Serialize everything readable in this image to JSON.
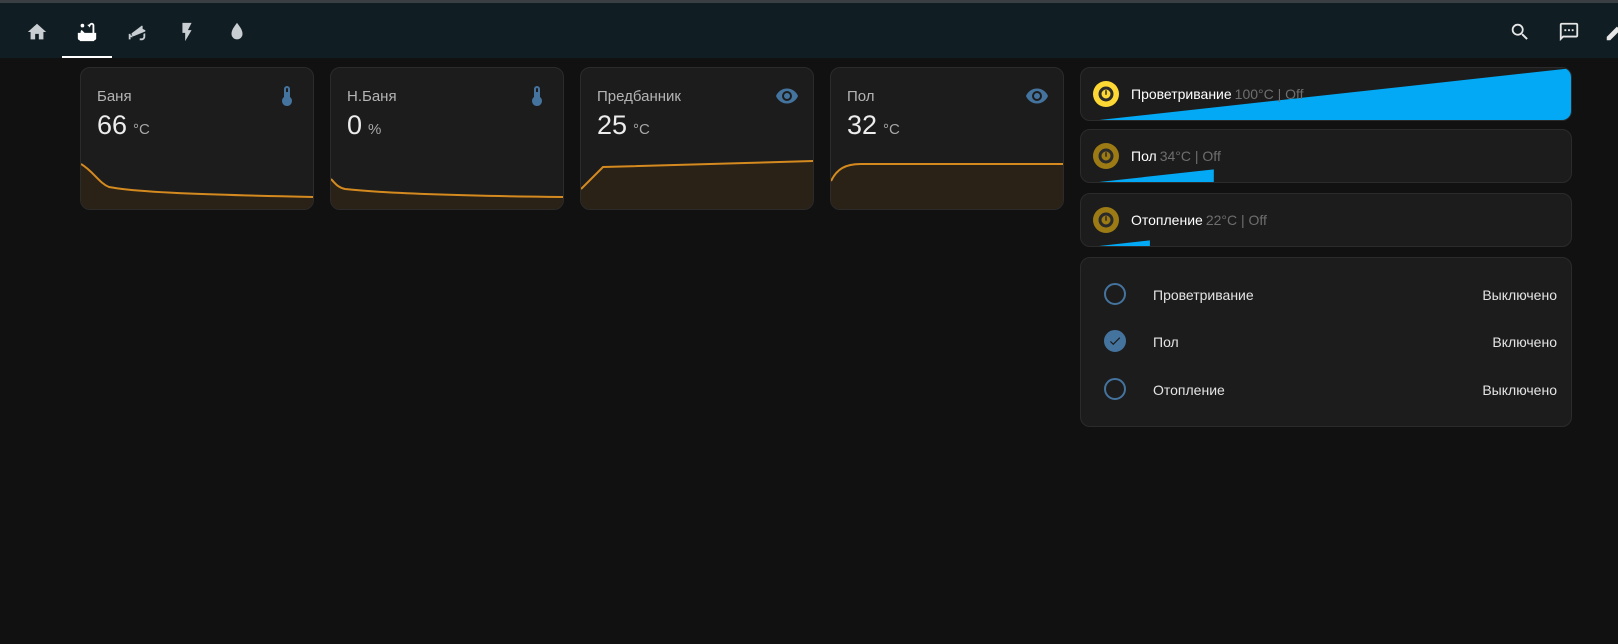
{
  "header": {
    "tabs": [
      {
        "icon": "home-icon",
        "active": false
      },
      {
        "icon": "bathtub-icon",
        "active": true
      },
      {
        "icon": "cctv-icon",
        "active": false
      },
      {
        "icon": "flash-icon",
        "active": false
      },
      {
        "icon": "water-drop-icon",
        "active": false
      }
    ],
    "actions": [
      "search-icon",
      "assist-icon",
      "edit-icon"
    ]
  },
  "colors": {
    "accent": "#44739e",
    "graph_line": "#d48a1f",
    "slider_fill": "#03a9f4",
    "badge_active": "#fdd835",
    "badge_dim": "#9c7a14"
  },
  "sensors": [
    {
      "name": "Баня",
      "value": "66",
      "unit": "°C",
      "icon": "thermometer-icon"
    },
    {
      "name": "Н.Баня",
      "value": "0",
      "unit": "%",
      "icon": "thermometer-icon"
    },
    {
      "name": "Предбанник",
      "value": "25",
      "unit": "°C",
      "icon": "eye-icon"
    },
    {
      "name": "Пол",
      "value": "32",
      "unit": "°C",
      "icon": "eye-icon"
    }
  ],
  "thermostats": [
    {
      "title": "Проветривание",
      "state": "100°C | Off",
      "level_percent": 100
    },
    {
      "title": "Пол",
      "state": "34°C | Off",
      "level_percent": 27
    },
    {
      "title": "Отопление",
      "state": "22°C | Off",
      "level_percent": 14
    }
  ],
  "entities": [
    {
      "name": "Проветривание",
      "state": "Выключено",
      "checked": false
    },
    {
      "name": "Пол",
      "state": "Включено",
      "checked": true
    },
    {
      "name": "Отопление",
      "state": "Выключено",
      "checked": false
    }
  ]
}
